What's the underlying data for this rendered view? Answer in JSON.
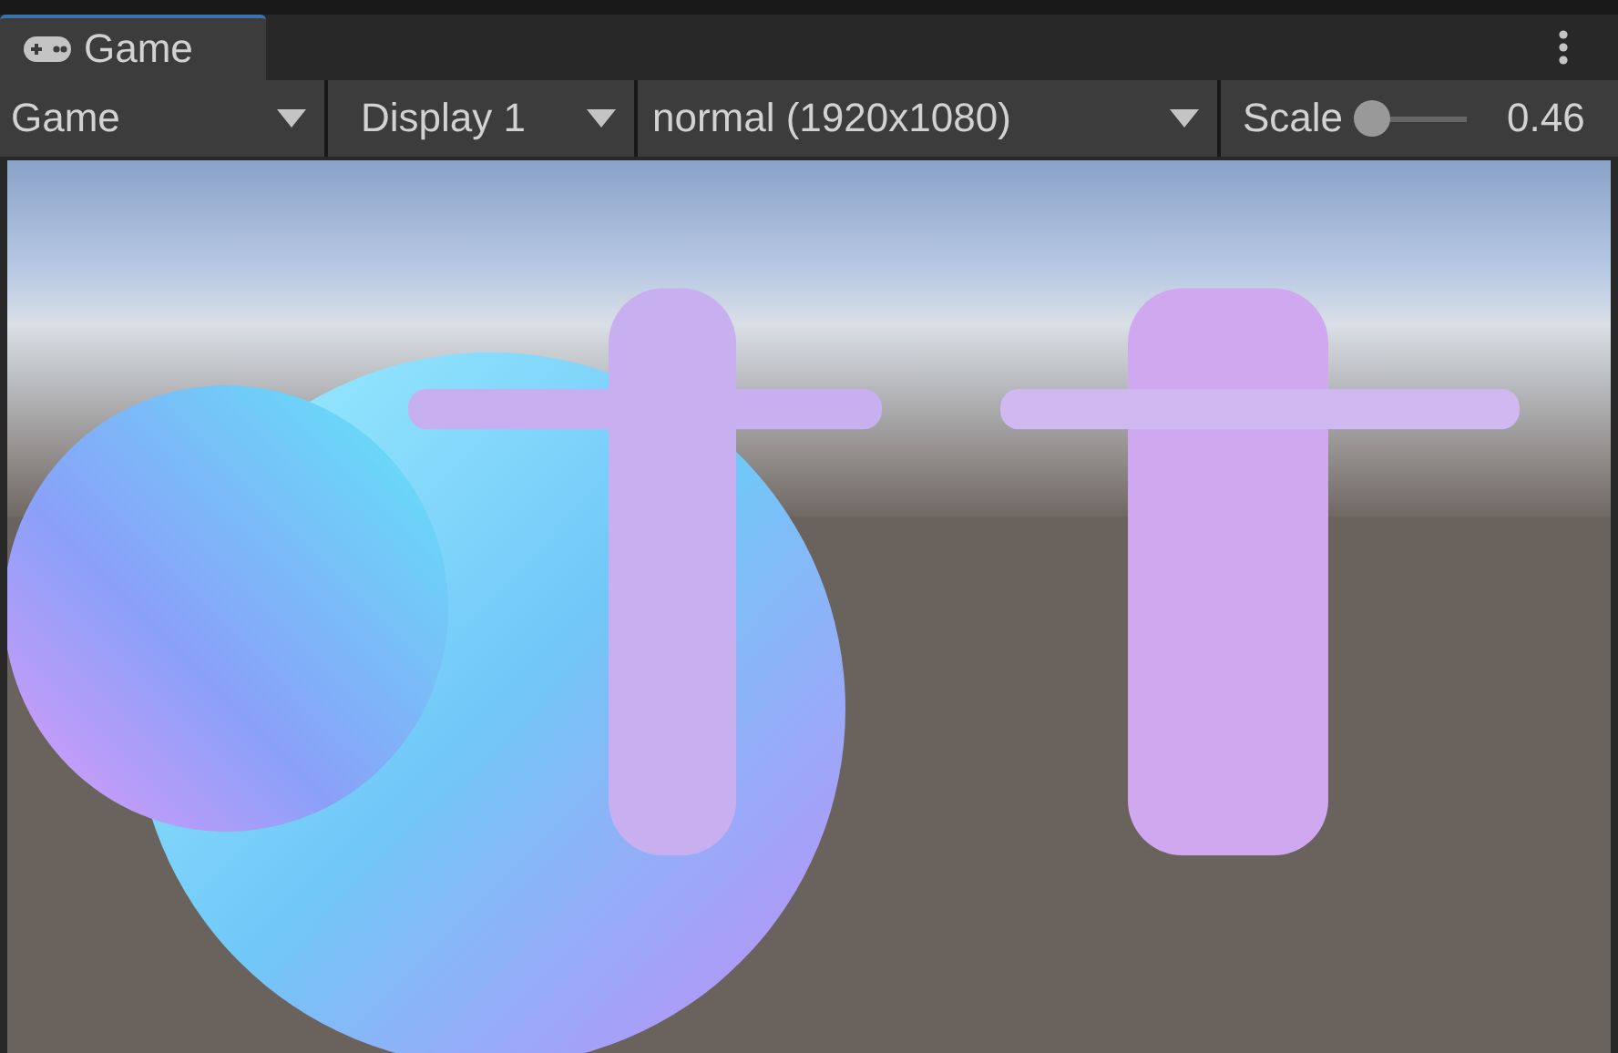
{
  "tab": {
    "label": "Game",
    "selected": true
  },
  "toolbar": {
    "dropdowns": [
      {
        "label": "Game"
      },
      {
        "label": "Display 1"
      },
      {
        "label": "normal (1920x1080)"
      }
    ],
    "scale": {
      "label": "Scale",
      "level": 0,
      "reading": "0.46"
    }
  }
}
